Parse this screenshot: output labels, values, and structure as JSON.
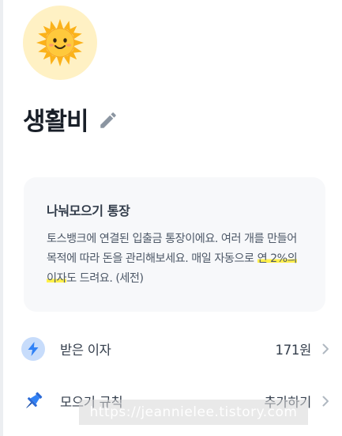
{
  "account": {
    "name": "생활비",
    "avatar_icon": "sun-icon",
    "edit_icon": "pencil-icon"
  },
  "info_card": {
    "title": "나눠모으기 통장",
    "desc_before": "토스뱅크에 연결된 입출금 통장이에요. 여러 개를 만들어 목적에 따라 돈을 관리해보세요. 매일 자동으로 ",
    "desc_highlight": "연 2%의 이자",
    "desc_after": "도 드려요. (세전)"
  },
  "rows": [
    {
      "icon": "lightning-icon",
      "label": "받은 이자",
      "value": "171원"
    },
    {
      "icon": "pushpin-icon",
      "label": "모으기 규칙",
      "value": "추가하기"
    }
  ],
  "watermark": "https://jeannielee.tistory.com",
  "colors": {
    "avatar_bg": "#fff1c4",
    "card_bg": "#f7f8fa",
    "highlight": "#fff04a",
    "bolt_icon": "#3182f6",
    "pin_icon": "#2b6ad6"
  }
}
